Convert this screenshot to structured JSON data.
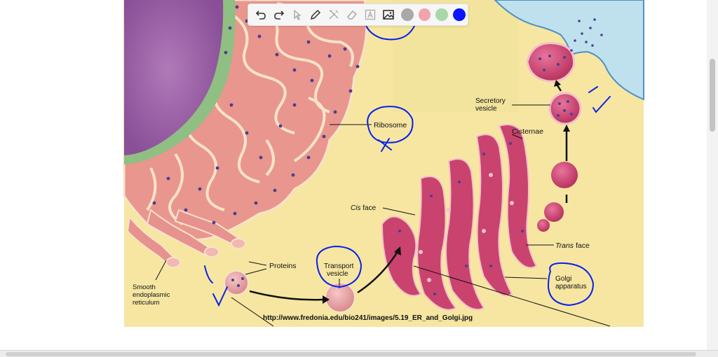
{
  "figure": {
    "source_url": "http://www.fredonia.edu/bio241/images/5.19_ER_and_Golgi.jpg",
    "labels": {
      "ribosome": "Ribosome",
      "cisternae": "Cisternae",
      "secretory_line1": "Secretory",
      "secretory_line2": "vesicle",
      "cis_italic": "Cis",
      "cis_rest": " face",
      "trans_italic": "Trans",
      "trans_rest": " face",
      "proteins": "Proteins",
      "transport_line1": "Transport",
      "transport_line2": "vesicle",
      "golgi_line1": "Golgi",
      "golgi_line2": "apparatus",
      "ser_line1": "Smooth",
      "ser_line2": "endoplasmic",
      "ser_line3": "reticulum"
    }
  },
  "toolbar": {
    "tools": [
      "undo-icon",
      "redo-icon",
      "pointer-icon",
      "pen-icon",
      "tools-icon",
      "eraser-icon",
      "text-icon",
      "image-icon"
    ],
    "colors": [
      "#a8a8a8",
      "#f2a3ad",
      "#a8d8a8",
      "#0a14ff"
    ]
  }
}
